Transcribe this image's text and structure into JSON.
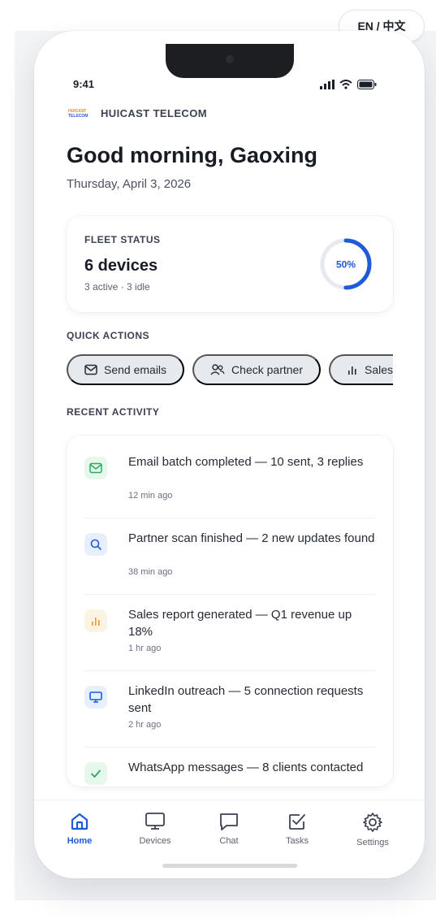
{
  "language_toggle": "EN / 中文",
  "status_bar": {
    "time": "9:41"
  },
  "brand": {
    "logo_line1": "HUICAST",
    "logo_line2": "TELECOM",
    "name": "HUICAST TELECOM"
  },
  "greeting": "Good morning, Gaoxing",
  "date": "Thursday, April 3, 2026",
  "fleet": {
    "label": "FLEET STATUS",
    "count": "6 devices",
    "summary": "3 active · 3 idle",
    "percent_label": "50%",
    "percent": 50
  },
  "quick_actions": {
    "title": "QUICK ACTIONS",
    "items": [
      {
        "label": "Send emails",
        "icon": "mail-icon"
      },
      {
        "label": "Check partner",
        "icon": "users-icon"
      },
      {
        "label": "Sales report",
        "icon": "bar-chart-icon"
      }
    ]
  },
  "recent_activity": {
    "title": "RECENT ACTIVITY",
    "items": [
      {
        "text": "Email batch completed — 10 sent, 3 replies",
        "time": "12 min ago",
        "icon": "mail-icon",
        "color": "#2fa864",
        "bg": "#e6f7ec"
      },
      {
        "text": "Partner scan finished — 2 new updates found",
        "time": "38 min ago",
        "icon": "search-icon",
        "color": "#1d5bd8",
        "bg": "#e7effc"
      },
      {
        "text": "Sales report generated — Q1 revenue up 18%",
        "time": "1 hr ago",
        "icon": "bar-chart-icon",
        "color": "#e89a2b",
        "bg": "#fdf3e2"
      },
      {
        "text": "LinkedIn outreach — 5 connection requests sent",
        "time": "2 hr ago",
        "icon": "monitor-icon",
        "color": "#1d5bd8",
        "bg": "#e7effc"
      },
      {
        "text": "WhatsApp messages — 8 clients contacted",
        "time": "",
        "icon": "check-icon",
        "color": "#2fa864",
        "bg": "#e6f7ec"
      }
    ]
  },
  "tabs": [
    {
      "label": "Home",
      "icon": "home-icon",
      "active": true
    },
    {
      "label": "Devices",
      "icon": "monitor-icon"
    },
    {
      "label": "Chat",
      "icon": "chat-icon"
    },
    {
      "label": "Tasks",
      "icon": "tasks-icon"
    },
    {
      "label": "Settings",
      "icon": "gear-icon"
    }
  ],
  "colors": {
    "accent": "#1d5bd8",
    "ring_track": "#e6e9ee"
  }
}
